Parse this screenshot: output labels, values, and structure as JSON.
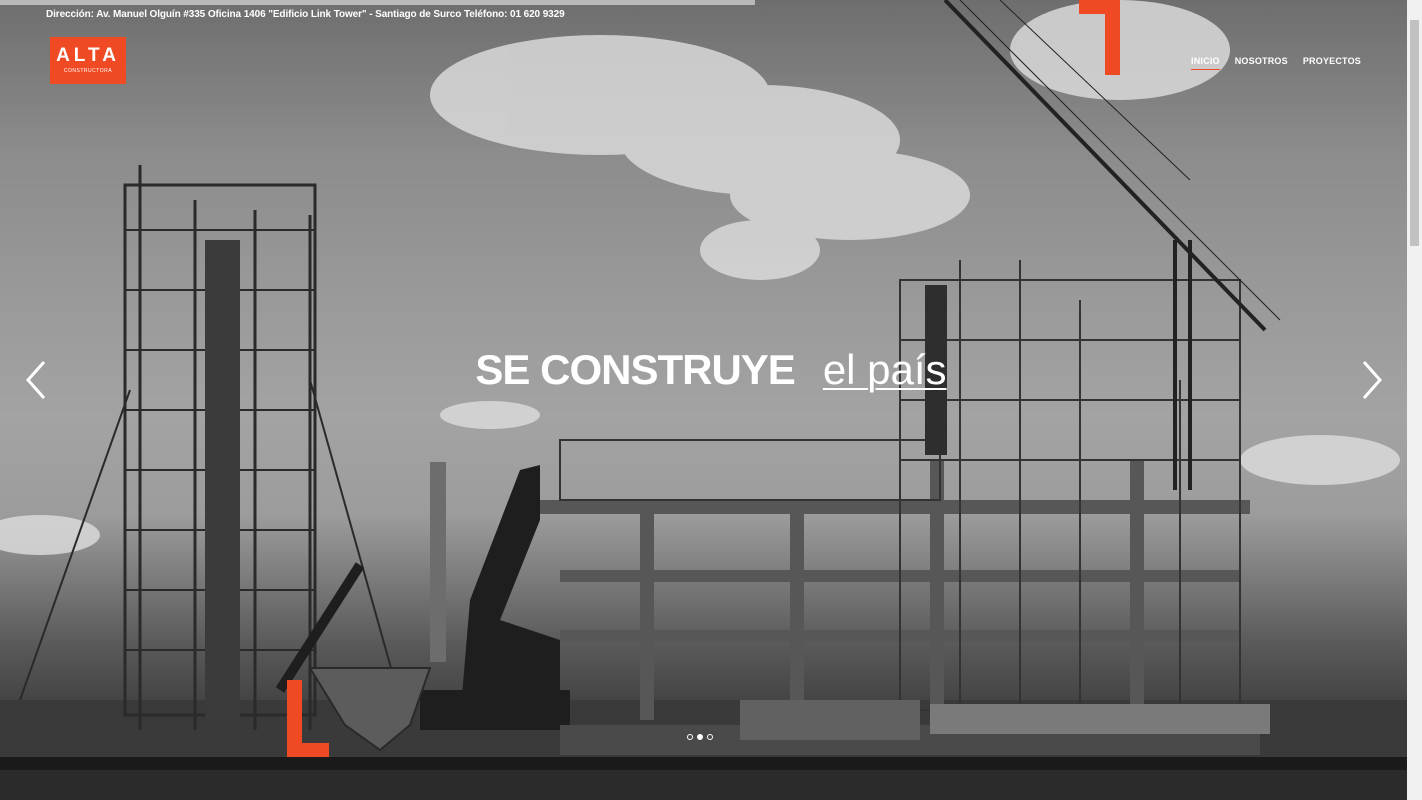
{
  "header": {
    "address": "Dirección: Av. Manuel Olguín #335 Oficina 1406 \"Edificio Link Tower\" - Santiago de Surco",
    "phone": "Teléfono: 01 620 9329"
  },
  "logo": {
    "mark": "ALTA",
    "subtitle": "CONSTRUCTORA"
  },
  "nav": {
    "items": [
      "INICIO",
      "NOSOTROS",
      "PROYECTOS"
    ],
    "active": "INICIO"
  },
  "slider": {
    "headline_bold": "SE CONSTRUYE",
    "headline_light": "el país",
    "prev_icon": "chevron-left-icon",
    "next_icon": "chevron-right-icon",
    "slide_count": 3,
    "active_slide": 2
  },
  "colors": {
    "accent": "#ef4a23",
    "text": "#ffffff"
  }
}
